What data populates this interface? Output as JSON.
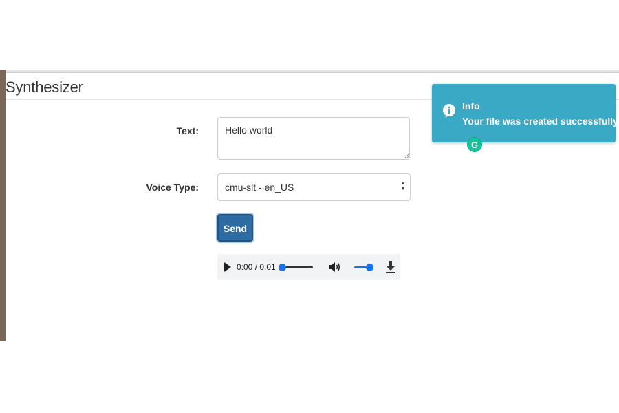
{
  "app": {
    "title": "Synthesizer"
  },
  "form": {
    "text_label": "Text:",
    "text_value": "Hello world",
    "voice_label": "Voice Type:",
    "voice_value": "cmu-slt - en_US",
    "send_label": "Send"
  },
  "audio_player": {
    "time": "0:00 / 0:01",
    "progress_fraction": 0.0,
    "volume_fraction": 1.0
  },
  "toast": {
    "title": "Info",
    "message": "Your file was created successfully.",
    "icon": "info-icon",
    "color": "#3aa9c5"
  },
  "extension_badge": {
    "label": "G",
    "color": "#15c39a"
  },
  "colors": {
    "send_button": "#2f6ba3",
    "slider_accent": "#1a73e8"
  }
}
